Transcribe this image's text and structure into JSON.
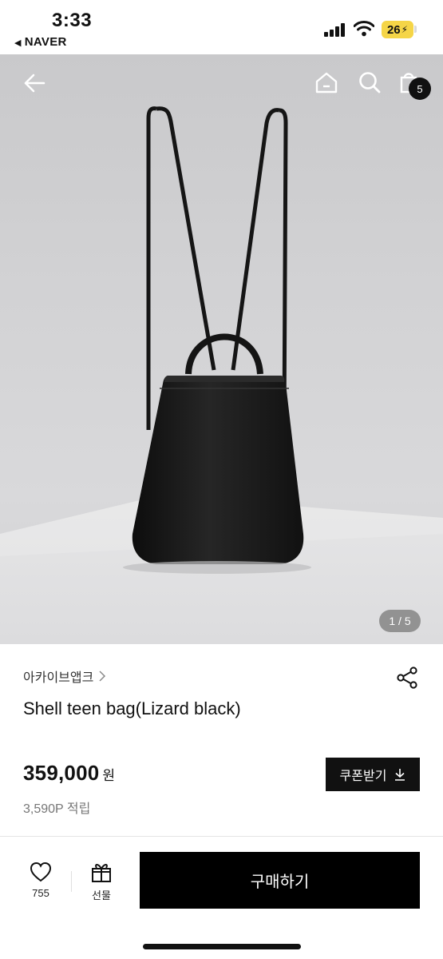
{
  "status_bar": {
    "time": "3:33",
    "back_app": "NAVER",
    "battery": "26"
  },
  "header": {
    "cart_count": "5",
    "icons": [
      "back-arrow-icon",
      "home-icon",
      "search-icon",
      "shopping-bag-icon"
    ]
  },
  "gallery": {
    "counter": "1 / 5",
    "current": 1,
    "total": 5
  },
  "product": {
    "brand": "아카이브앱크",
    "title": "Shell teen bag(Lizard black)",
    "price": "359,000",
    "currency": "원",
    "points": "3,590P 적립"
  },
  "actions": {
    "coupon_label": "쿠폰받기",
    "like_count": "755",
    "gift_label": "선물",
    "buy_label": "구매하기"
  },
  "colors": {
    "primary": "#000000",
    "battery": "#f5d547",
    "background": "#ffffff"
  }
}
